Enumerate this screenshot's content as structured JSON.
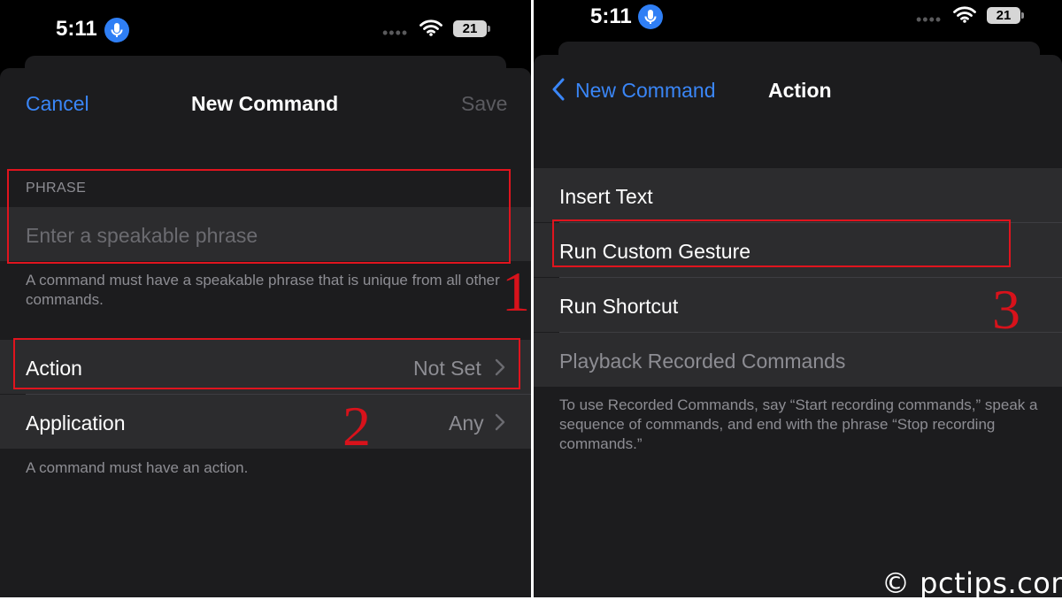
{
  "status_bar": {
    "time": "5:11",
    "battery": "21",
    "icons": [
      "microphone-icon",
      "cellular-dots-icon",
      "wifi-icon",
      "battery-icon"
    ]
  },
  "left_screen": {
    "nav": {
      "cancel_label": "Cancel",
      "title": "New Command",
      "save_label": "Save"
    },
    "phrase_section": {
      "header": "PHRASE",
      "placeholder": "Enter a speakable phrase",
      "footer": "A command must have a speakable phrase that is unique from all other commands."
    },
    "settings": [
      {
        "label": "Action",
        "value": "Not Set"
      },
      {
        "label": "Application",
        "value": "Any"
      }
    ],
    "settings_footer": "A command must have an action."
  },
  "right_screen": {
    "nav": {
      "back_label": "New Command",
      "title": "Action"
    },
    "options": [
      {
        "label": "Insert Text",
        "disabled": false
      },
      {
        "label": "Run Custom Gesture",
        "disabled": false
      },
      {
        "label": "Run Shortcut",
        "disabled": false
      },
      {
        "label": "Playback Recorded Commands",
        "disabled": true
      }
    ],
    "footer": "To use Recorded Commands, say “Start recording commands,” speak a sequence of commands, and end with the phrase “Stop recording commands.”"
  },
  "annotations": [
    "1",
    "2",
    "3"
  ],
  "watermark": "© pctips.com",
  "colors": {
    "accent": "#3a86f7",
    "highlight": "#e0141e",
    "background": "#000000",
    "sheet": "#1c1c1e",
    "cell": "#2c2c2e"
  }
}
